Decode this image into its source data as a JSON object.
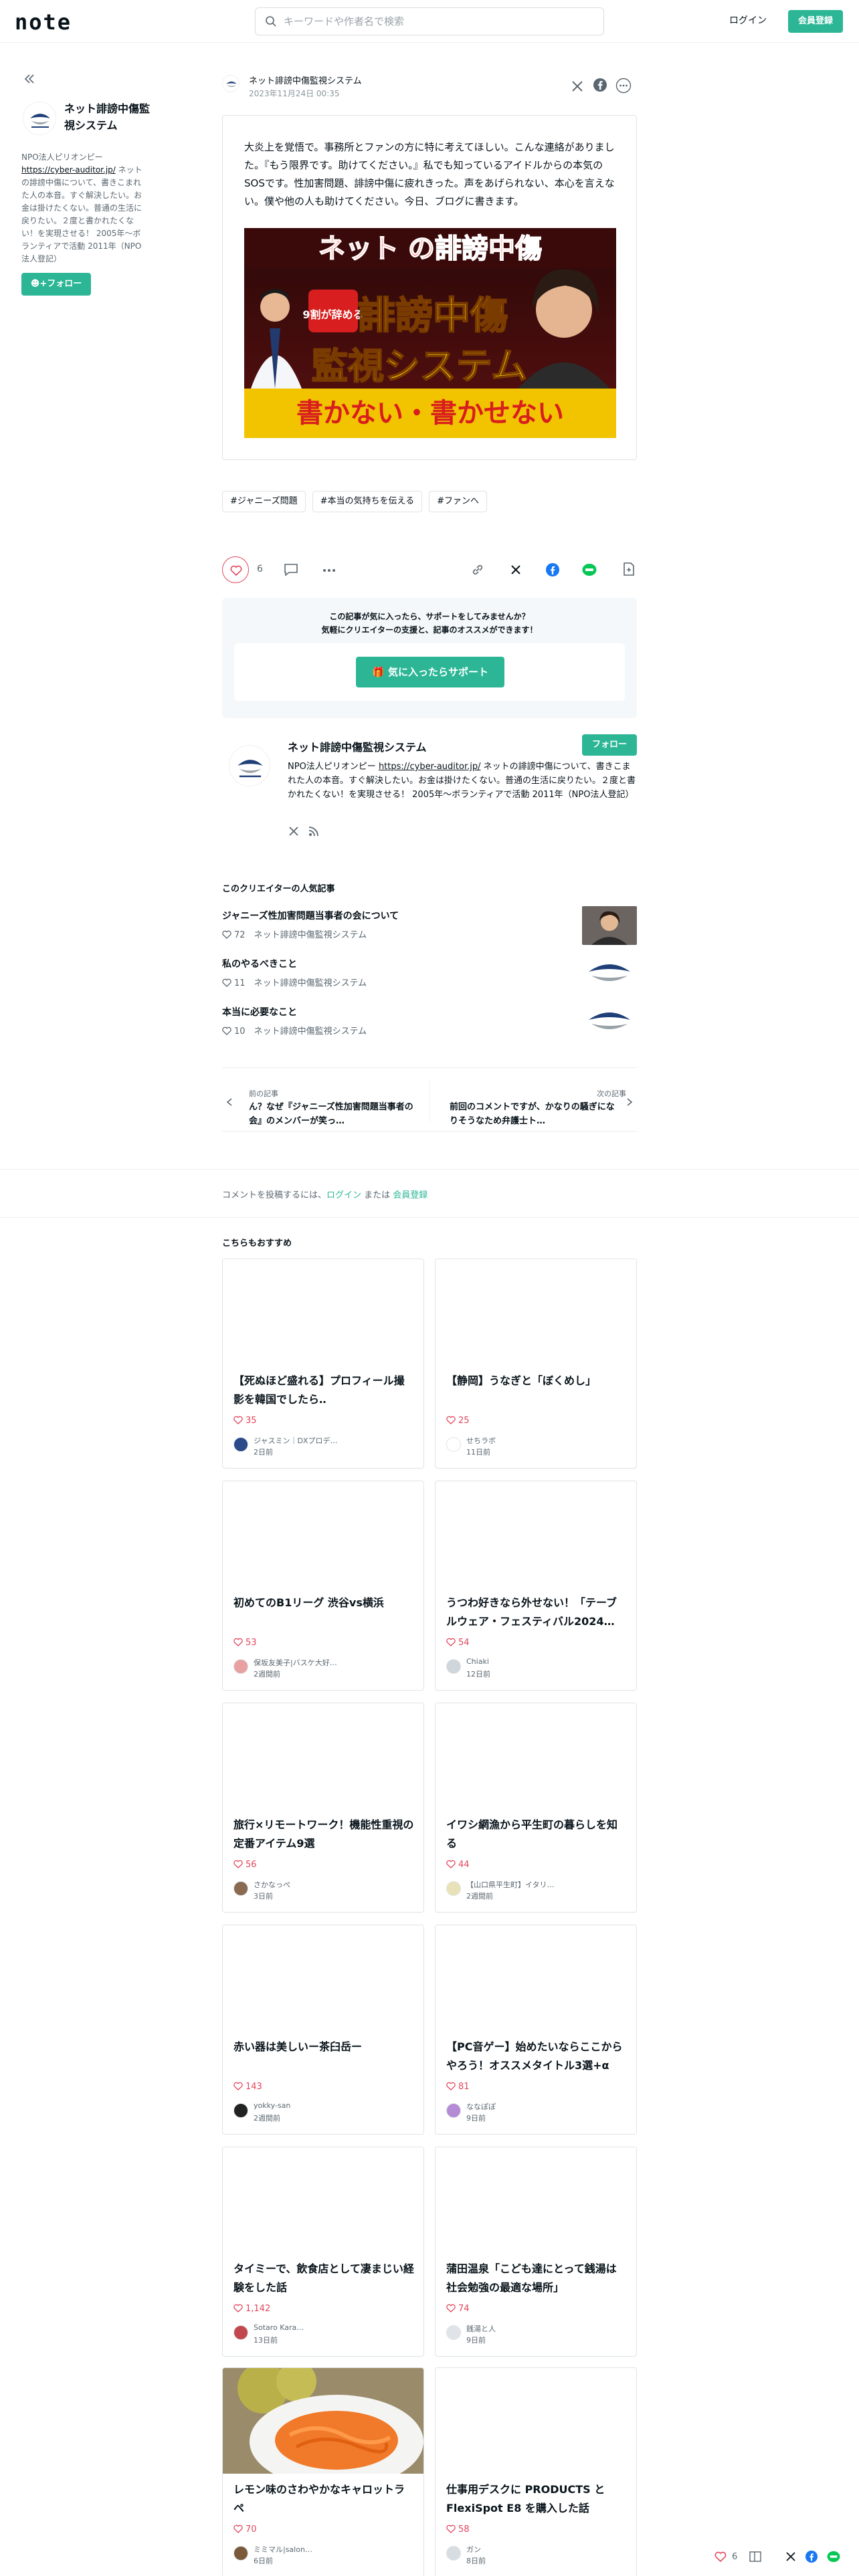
{
  "header": {
    "logo": "note",
    "search_placeholder": "キーワードや作者名で検索",
    "login": "ログイン",
    "register": "会員登録"
  },
  "sidebar": {
    "name": "ネット誹謗中傷監視システム",
    "bio_prefix": "NPO法人ピリオンピー",
    "bio_link": "https://cyber-auditor.jp/",
    "bio_suffix": " ネットの誹謗中傷について、書きこまれた人の本音。すぐ解決したい。お金は掛けたくない。普通の生活に戻りたい。２度と書かれたくない！を実現させる！ 2005年〜ボランティアで活動 2011年（NPO法人登記）",
    "follow": "フォロー"
  },
  "article": {
    "author": "ネット誹謗中傷監視システム",
    "date": "2023年11月24日 00:35",
    "embed_text": "大炎上を覚悟で。事務所とファンの方に特に考えてほしい。こんな連絡がありました。『もう限界です。助けてください。』私でも知っているアイドルからの本気のSOSです。性加害問題、誹謗中傷に疲れきった。声をあげられない、本心を言えない。僕や他の人も助けてください。今日、ブログに書きます。",
    "thumb_line1": "ネット の誹謗中傷",
    "thumb_badge": "9割が辞める",
    "thumb_line2": "誹謗中傷",
    "thumb_line3": "監視システム",
    "thumb_banner": "書かない・書かせない",
    "tags": [
      "#ジャニーズ問題",
      "#本当の気持ちを伝える",
      "#ファンへ"
    ],
    "like_count": "6"
  },
  "support": {
    "message_line1": "この記事が気に入ったら、サポートをしてみませんか？",
    "message_line2": "気軽にクリエイターの支援と、記事のオススメができます！",
    "button": "気に入ったらサポート"
  },
  "creator": {
    "name": "ネット誹謗中傷監視システム",
    "follow": "フォロー",
    "bio_prefix": "NPO法人ピリオンピー ",
    "bio_link": "https://cyber-auditor.jp/",
    "bio_suffix": " ネットの誹謗中傷について、書きこまれた人の本音。すぐ解決したい。お金は掛けたくない。普通の生活に戻りたい。２度と書かれたくない！を実現させる！ 2005年〜ボランティアで活動 2011年（NPO法人登記）"
  },
  "popular": {
    "title": "このクリエイターの人気記事",
    "items": [
      {
        "title": "ジャニーズ性加害問題当事者の会について",
        "likes": "72",
        "author": "ネット誹謗中傷監視システム"
      },
      {
        "title": "私のやるべきこと",
        "likes": "11",
        "author": "ネット誹謗中傷監視システム"
      },
      {
        "title": "本当に必要なこと",
        "likes": "10",
        "author": "ネット誹謗中傷監視システム"
      }
    ]
  },
  "prevnext": {
    "prev_label": "前の記事",
    "prev_title": "ん？なぜ『ジャニーズ性加害問題当事者の会』のメンバーが笑っ…",
    "next_label": "次の記事",
    "next_title": "前回のコメントですが、かなりの騒ぎになりそうなため弁護士ト…"
  },
  "comment": {
    "prefix": "コメントを投稿するには、",
    "login": "ログイン",
    "middle": " または ",
    "register": "会員登録"
  },
  "recommend": {
    "title": "こちらもおすすめ",
    "cards": [
      {
        "title": "【死ぬほど盛れる】プロフィール撮影を韓国でしたら‥",
        "likes": "35",
        "author": "ジャスミン｜DXプロデ…",
        "time": "2日前"
      },
      {
        "title": "【静岡】うなぎと「ぼくめし」",
        "likes": "25",
        "author": "せちラボ",
        "time": "11日前"
      },
      {
        "title": "初めてのB1リーグ 渋谷vs横浜",
        "likes": "53",
        "author": "保坂友美子|バスケ大好…",
        "time": "2週間前"
      },
      {
        "title": "うつわ好きなら外せない！「テーブルウェア・フェスティバル2024…",
        "likes": "54",
        "author": "Chiaki",
        "time": "12日前"
      },
      {
        "title": "旅行×リモートワーク！機能性重視の定番アイテム9選",
        "likes": "56",
        "author": "さかなっぺ",
        "time": "3日前"
      },
      {
        "title": "イワシ網漁から平生町の暮らしを知る",
        "likes": "44",
        "author": "【山口県平生町】イタリ…",
        "time": "2週間前"
      },
      {
        "title": "赤い器は美しいー茶臼岳ー",
        "likes": "143",
        "author": "yokky-san",
        "time": "2週間前"
      },
      {
        "title": "【PC音ゲー】始めたいならここからやろう！オススメタイトル3選+α",
        "likes": "81",
        "author": "ななぽぽ",
        "time": "9日前"
      },
      {
        "title": "タイミーで、飲食店として凄まじい経験をした話",
        "likes": "1,142",
        "author": "Sotaro Kara…",
        "time": "13日前"
      },
      {
        "title": "蒲田温泉「こども達にとって銭湯は社会勉強の最適な場所」",
        "likes": "74",
        "author": "銭湯と人",
        "time": "9日前"
      },
      {
        "title": "レモン味のさわやかなキャロットラペ",
        "likes": "70",
        "author": "ミミマル|salon…",
        "time": "6日前"
      },
      {
        "title": "仕事用デスクに PRODUCTS と FlexiSpot E8 を購入した話",
        "likes": "58",
        "author": "ガン",
        "time": "8日前"
      }
    ]
  },
  "floating": {
    "like_count": "6"
  },
  "colors": {
    "brand": "#2cb696",
    "like": "#e2465c",
    "text": "#08131a"
  }
}
